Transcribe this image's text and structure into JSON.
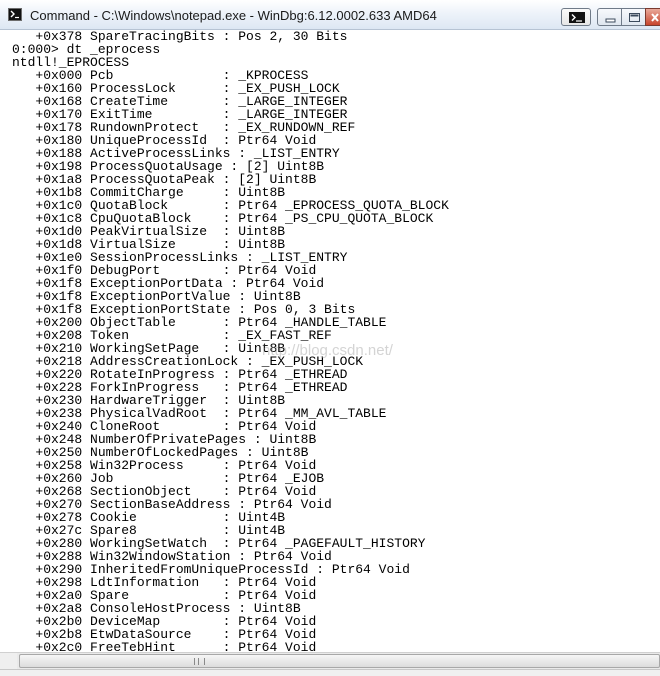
{
  "window": {
    "title": "Command - C:\\Windows\\notepad.exe - WinDbg:6.12.0002.633 AMD64"
  },
  "icons": {
    "app": "console-prompt-icon",
    "console_button": "console-prompt-icon",
    "minimize": "minimize-icon",
    "maximize": "maximize-icon",
    "close": "close-icon",
    "scrollbar_grip": "grip-icon"
  },
  "colors": {
    "titlebar_top": "#ffffff",
    "titlebar_bottom": "#dde7f3",
    "text": "#000000",
    "close_button": "#c8452c"
  },
  "watermark": "http://blog.csdn.net/",
  "console": {
    "lines": [
      "   +0x378 SpareTracingBits : Pos 2, 30 Bits",
      "0:000> dt _eprocess",
      "ntdll!_EPROCESS",
      "   +0x000 Pcb              : _KPROCESS",
      "   +0x160 ProcessLock      : _EX_PUSH_LOCK",
      "   +0x168 CreateTime       : _LARGE_INTEGER",
      "   +0x170 ExitTime         : _LARGE_INTEGER",
      "   +0x178 RundownProtect   : _EX_RUNDOWN_REF",
      "   +0x180 UniqueProcessId  : Ptr64 Void",
      "   +0x188 ActiveProcessLinks : _LIST_ENTRY",
      "   +0x198 ProcessQuotaUsage : [2] Uint8B",
      "   +0x1a8 ProcessQuotaPeak : [2] Uint8B",
      "   +0x1b8 CommitCharge     : Uint8B",
      "   +0x1c0 QuotaBlock       : Ptr64 _EPROCESS_QUOTA_BLOCK",
      "   +0x1c8 CpuQuotaBlock    : Ptr64 _PS_CPU_QUOTA_BLOCK",
      "   +0x1d0 PeakVirtualSize  : Uint8B",
      "   +0x1d8 VirtualSize      : Uint8B",
      "   +0x1e0 SessionProcessLinks : _LIST_ENTRY",
      "   +0x1f0 DebugPort        : Ptr64 Void",
      "   +0x1f8 ExceptionPortData : Ptr64 Void",
      "   +0x1f8 ExceptionPortValue : Uint8B",
      "   +0x1f8 ExceptionPortState : Pos 0, 3 Bits",
      "   +0x200 ObjectTable      : Ptr64 _HANDLE_TABLE",
      "   +0x208 Token            : _EX_FAST_REF",
      "   +0x210 WorkingSetPage   : Uint8B",
      "   +0x218 AddressCreationLock : _EX_PUSH_LOCK",
      "   +0x220 RotateInProgress : Ptr64 _ETHREAD",
      "   +0x228 ForkInProgress   : Ptr64 _ETHREAD",
      "   +0x230 HardwareTrigger  : Uint8B",
      "   +0x238 PhysicalVadRoot  : Ptr64 _MM_AVL_TABLE",
      "   +0x240 CloneRoot        : Ptr64 Void",
      "   +0x248 NumberOfPrivatePages : Uint8B",
      "   +0x250 NumberOfLockedPages : Uint8B",
      "   +0x258 Win32Process     : Ptr64 Void",
      "   +0x260 Job              : Ptr64 _EJOB",
      "   +0x268 SectionObject    : Ptr64 Void",
      "   +0x270 SectionBaseAddress : Ptr64 Void",
      "   +0x278 Cookie           : Uint4B",
      "   +0x27c Spare8           : Uint4B",
      "   +0x280 WorkingSetWatch  : Ptr64 _PAGEFAULT_HISTORY",
      "   +0x288 Win32WindowStation : Ptr64 Void",
      "   +0x290 InheritedFromUniqueProcessId : Ptr64 Void",
      "   +0x298 LdtInformation   : Ptr64 Void",
      "   +0x2a0 Spare            : Ptr64 Void",
      "   +0x2a8 ConsoleHostProcess : Uint8B",
      "   +0x2b0 DeviceMap        : Ptr64 Void",
      "   +0x2b8 EtwDataSource    : Ptr64 Void",
      "   +0x2c0 FreeTebHint      : Ptr64 Void"
    ]
  }
}
